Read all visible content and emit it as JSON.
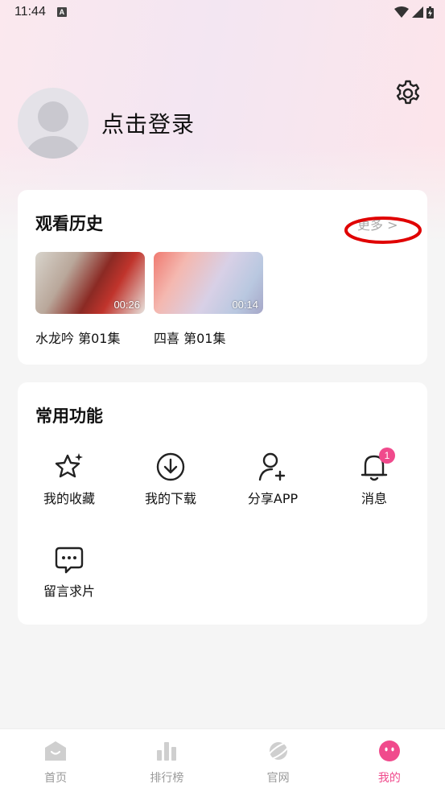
{
  "status_bar": {
    "time": "11:44"
  },
  "profile": {
    "login_text": "点击登录"
  },
  "history": {
    "title": "观看历史",
    "more_label": "更多 >",
    "items": [
      {
        "title": "水龙吟 第01集",
        "duration": "00:26"
      },
      {
        "title": "四喜 第01集",
        "duration": "00:14"
      }
    ]
  },
  "functions": {
    "title": "常用功能",
    "items": [
      {
        "label": "我的收藏",
        "icon": "star-sparkle-icon"
      },
      {
        "label": "我的下载",
        "icon": "download-icon"
      },
      {
        "label": "分享APP",
        "icon": "share-user-icon"
      },
      {
        "label": "消息",
        "icon": "bell-icon",
        "badge": "1"
      },
      {
        "label": "留言求片",
        "icon": "chat-icon"
      }
    ]
  },
  "bottom_nav": {
    "items": [
      {
        "label": "首页",
        "icon": "home-icon"
      },
      {
        "label": "排行榜",
        "icon": "ranking-icon"
      },
      {
        "label": "官网",
        "icon": "planet-icon"
      },
      {
        "label": "我的",
        "icon": "profile-face-icon",
        "active": true
      }
    ]
  },
  "colors": {
    "accent": "#f04a8c",
    "annotation": "#e00000"
  }
}
